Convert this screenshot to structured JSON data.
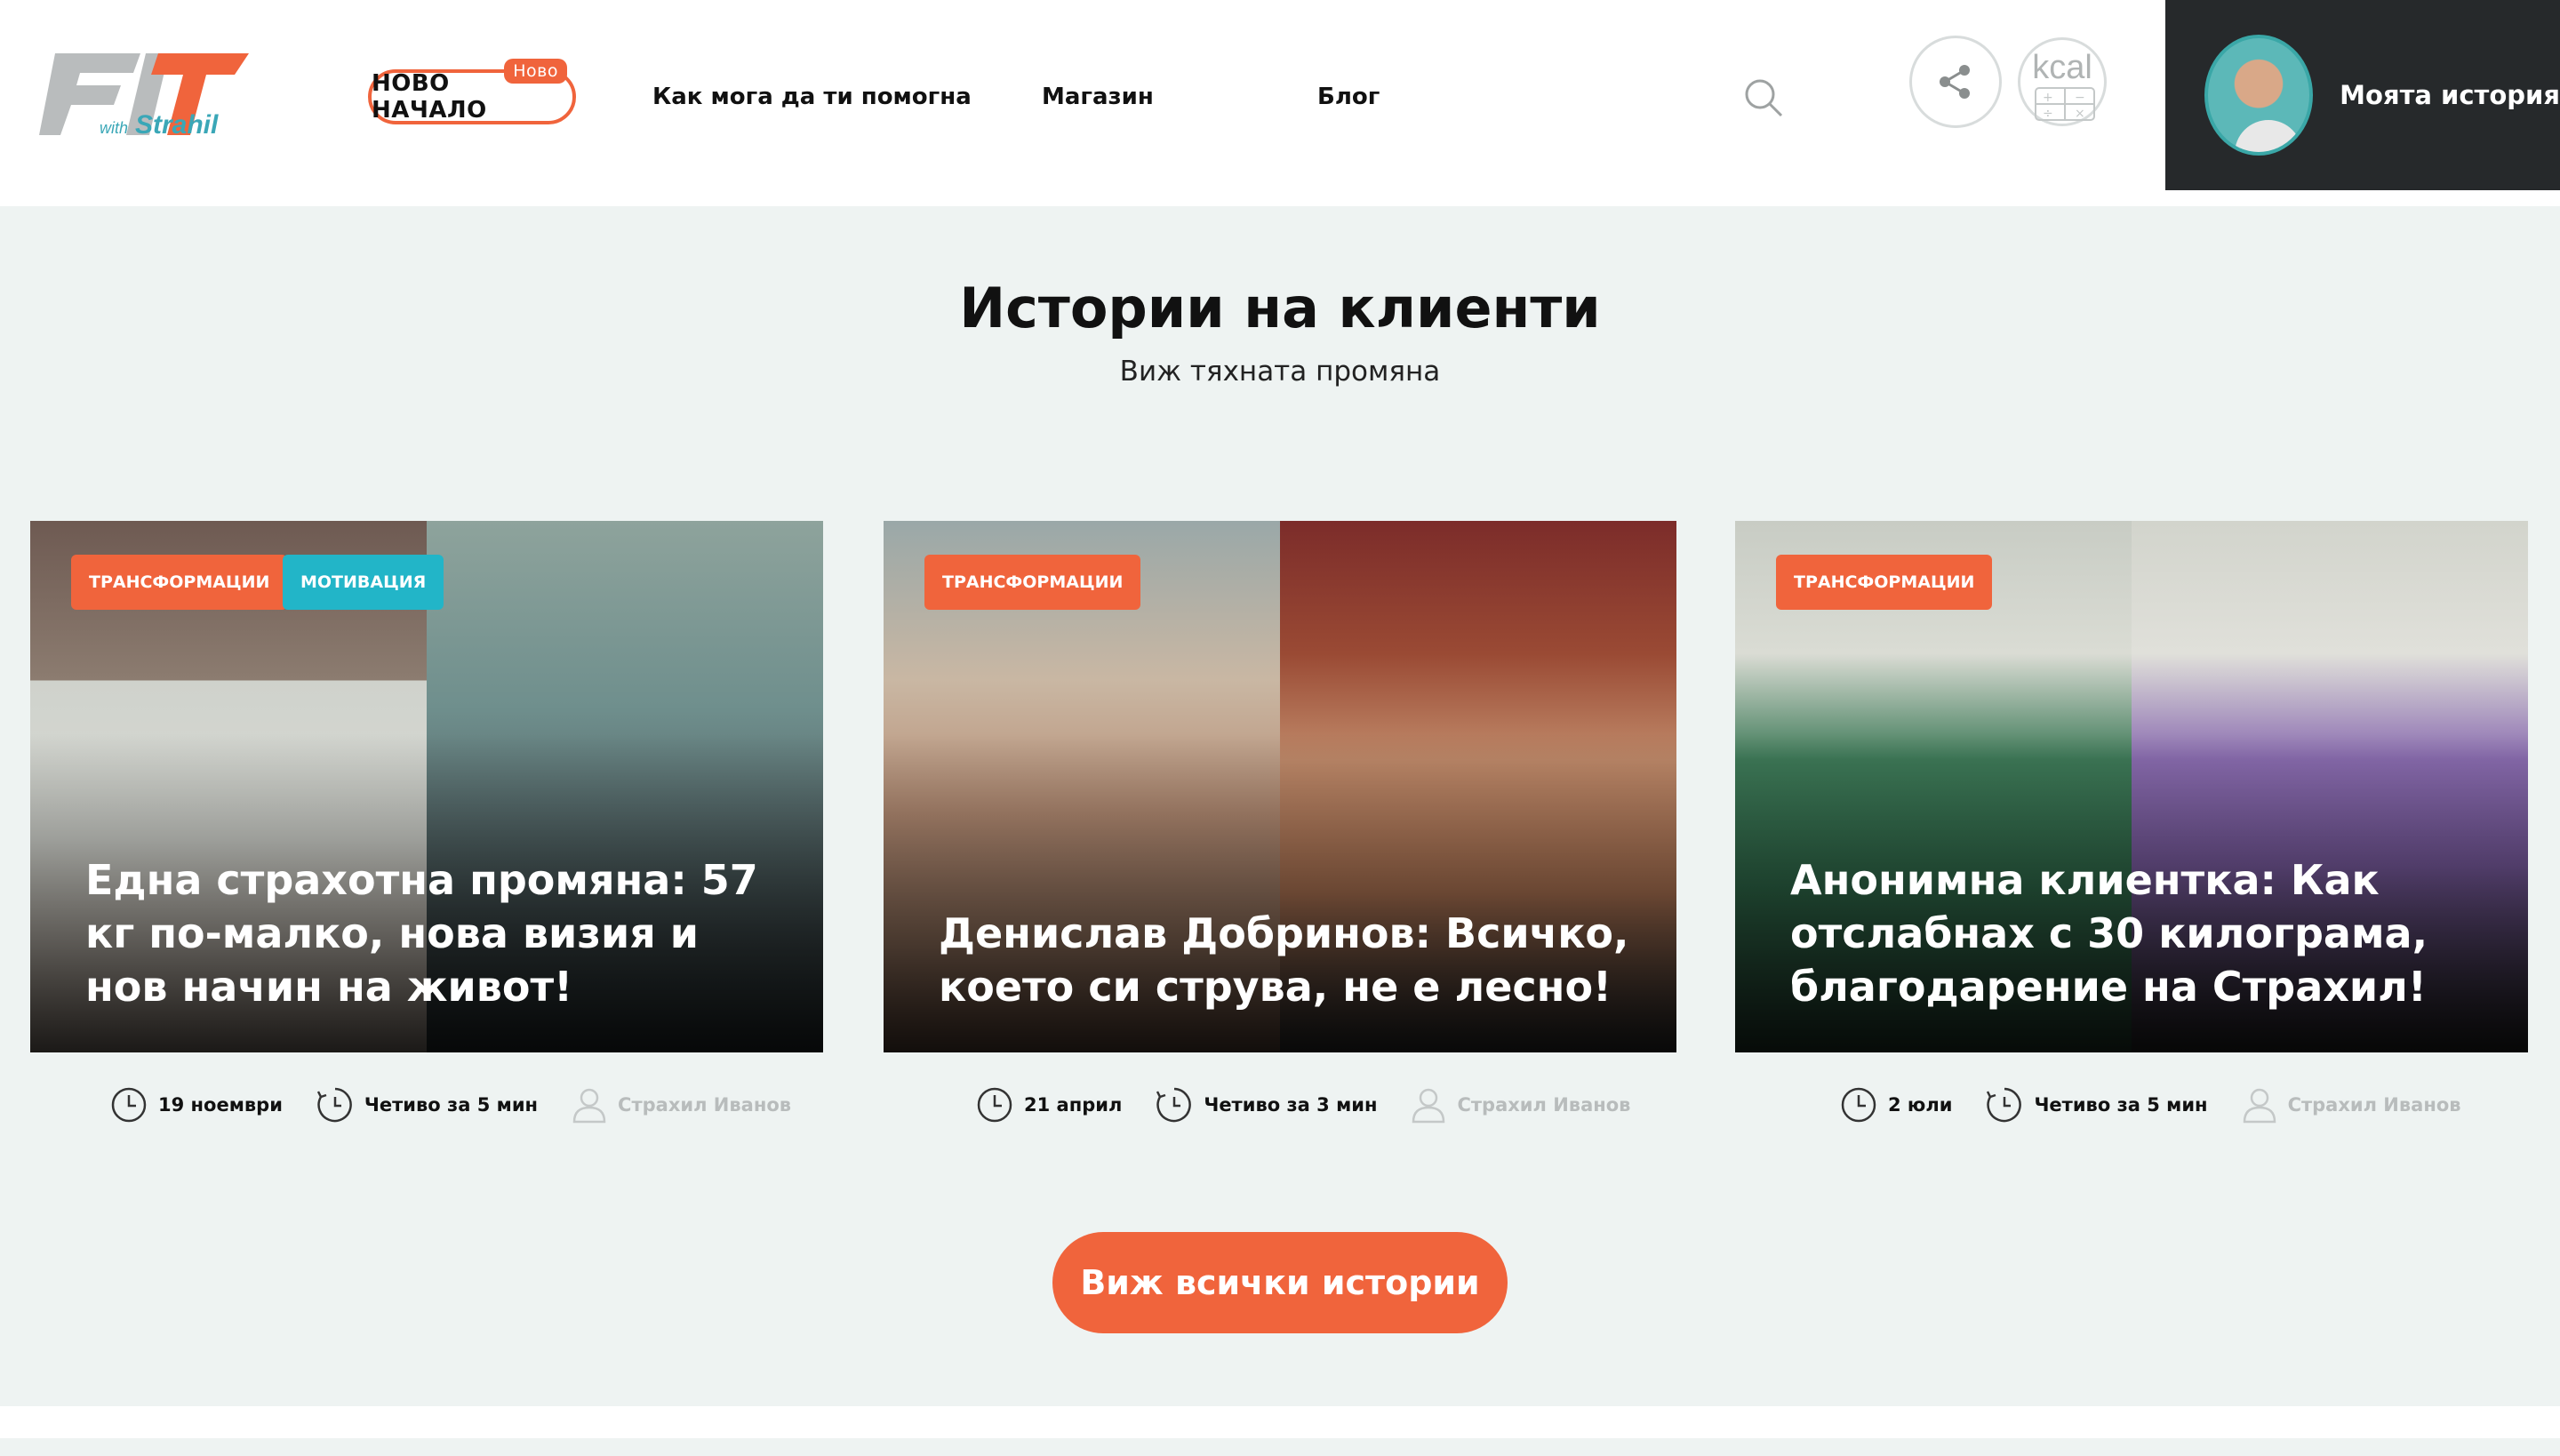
{
  "header": {
    "logo": {
      "main": "FIT",
      "sub_with": "with",
      "sub_name": "Strahil"
    },
    "nav_new": {
      "label": "НОВО НАЧАЛО",
      "badge": "Ново"
    },
    "nav_links": [
      "Как мога да ти помогна",
      "Магазин",
      "Блог"
    ],
    "kcal_label": "kcal",
    "my_story_label": "Моята история",
    "icons": [
      "search-icon",
      "share-icon",
      "calculator-icon"
    ]
  },
  "section": {
    "title": "Истории на клиенти",
    "subtitle": "Виж тяхната промяна"
  },
  "cards": [
    {
      "tags": [
        "ТРАНСФОРМАЦИИ",
        "МОТИВАЦИЯ"
      ],
      "title": "Една страхотна промяна: 57 кг по-малко, нова визия и нов начин на живот!",
      "date": "19 ноември",
      "read_time": "Четиво за 5 мин",
      "author": "Страхил Иванов"
    },
    {
      "tags": [
        "ТРАНСФОРМАЦИИ"
      ],
      "title": "Денислав Добринов: Всичко, което си струва, не е лесно!",
      "date": "21 април",
      "read_time": "Четиво за 3 мин",
      "author": "Страхил Иванов"
    },
    {
      "tags": [
        "ТРАНСФОРМАЦИИ"
      ],
      "title": "Анонимна клиентка: Как отслабнах с 30 килограма, благодарение на Страхил!",
      "date": "2 юли",
      "read_time": "Четиво за 5 мин",
      "author": "Страхил Иванов"
    }
  ],
  "cta_label": "Виж всички истории",
  "colors": {
    "accent": "#f0643c",
    "teal": "#22b5c8",
    "dark_panel": "#26292b",
    "background": "#eef3f2"
  }
}
